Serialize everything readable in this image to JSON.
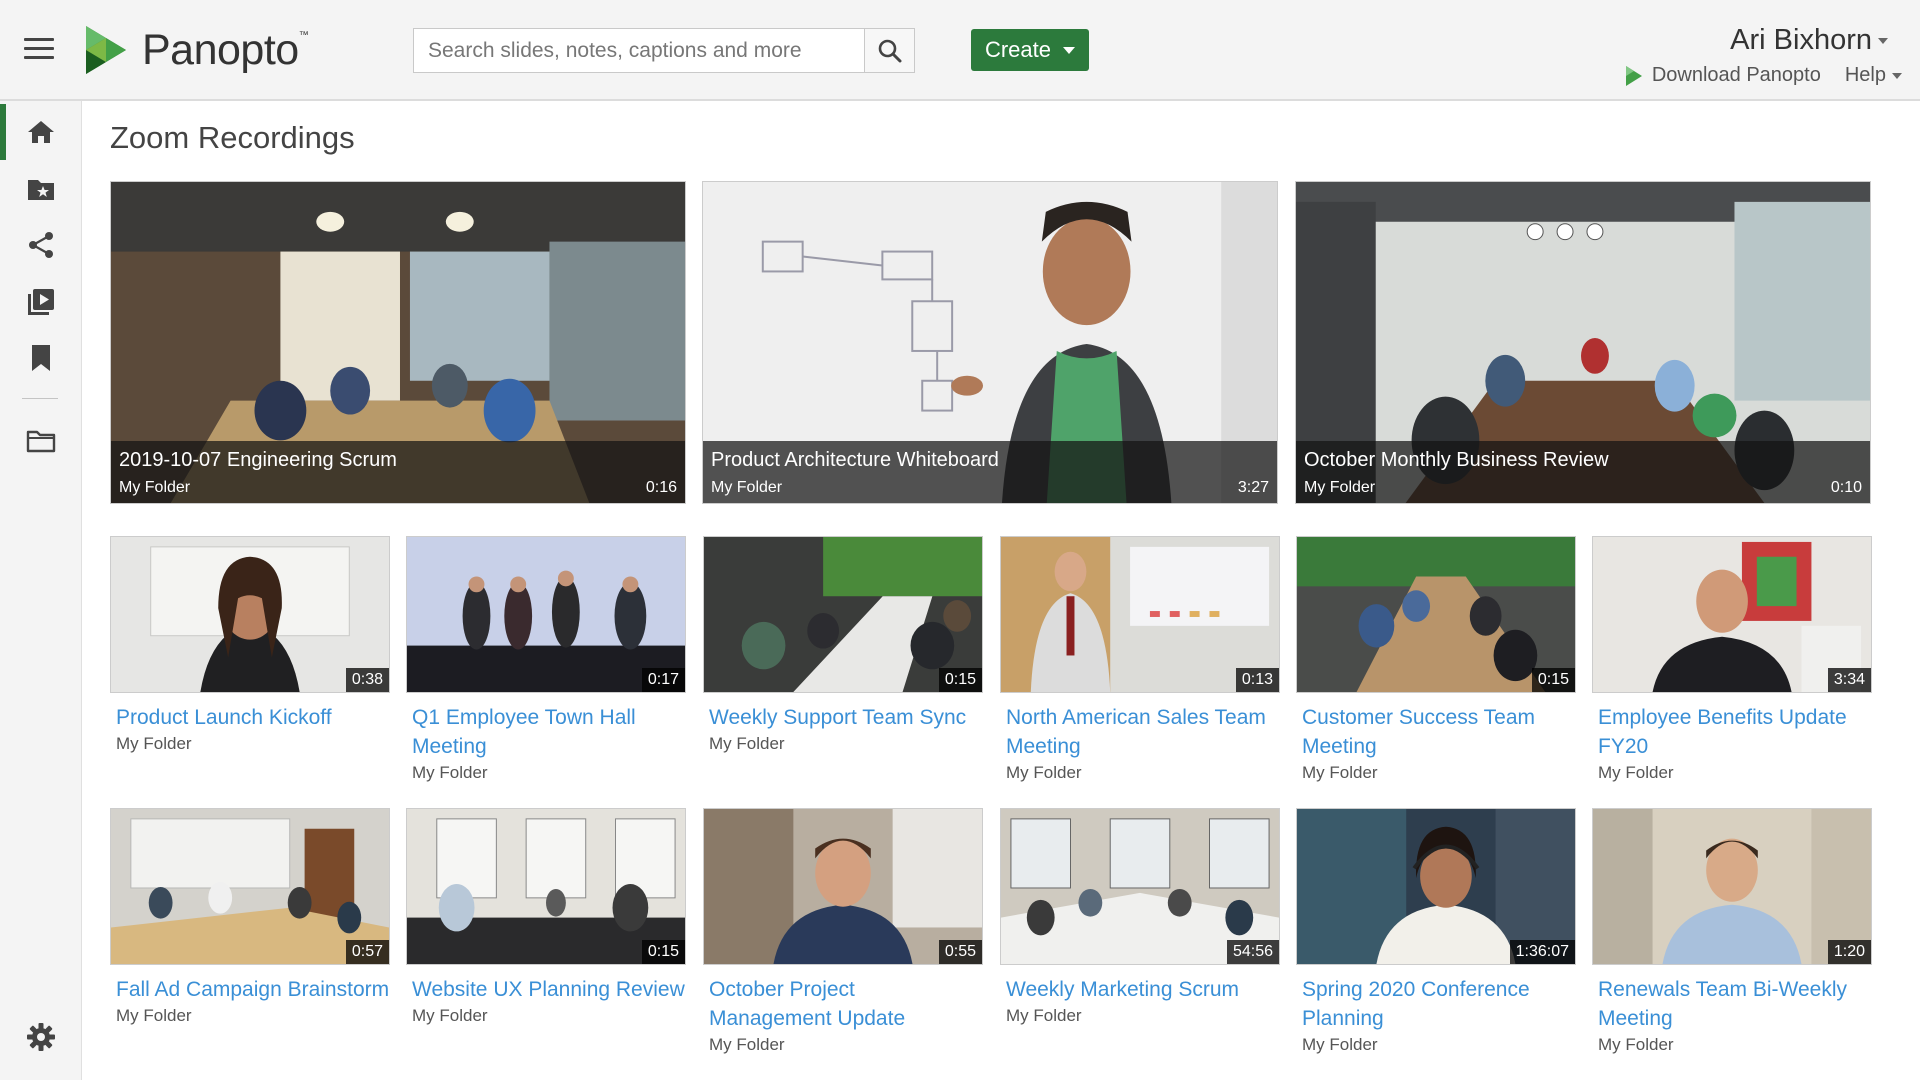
{
  "header": {
    "logo_text": "Panopto",
    "search_placeholder": "Search slides, notes, captions and more",
    "create_label": "Create",
    "user_name": "Ari Bixhorn",
    "download_label": "Download Panopto",
    "help_label": "Help"
  },
  "sidebar": {
    "items": [
      {
        "icon": "home-icon"
      },
      {
        "icon": "starred-folder-icon"
      },
      {
        "icon": "share-icon"
      },
      {
        "icon": "video-library-icon"
      },
      {
        "icon": "bookmark-icon"
      },
      {
        "icon": "folder-icon"
      },
      {
        "icon": "settings-icon"
      }
    ]
  },
  "main": {
    "title": "Zoom Recordings",
    "featured": [
      {
        "title": "2019-10-07 Engineering Scrum",
        "folder": "My Folder",
        "duration": "0:16"
      },
      {
        "title": "Product Architecture Whiteboard",
        "folder": "My Folder",
        "duration": "3:27"
      },
      {
        "title": "October Monthly Business Review",
        "folder": "My Folder",
        "duration": "0:10"
      }
    ],
    "row1": [
      {
        "title": "Product Launch Kickoff",
        "folder": "My Folder",
        "duration": "0:38"
      },
      {
        "title": "Q1 Employee Town Hall Meeting",
        "folder": "My Folder",
        "duration": "0:17"
      },
      {
        "title": "Weekly Support Team Sync",
        "folder": "My Folder",
        "duration": "0:15"
      },
      {
        "title": "North American Sales Team Meeting",
        "folder": "My Folder",
        "duration": "0:13"
      },
      {
        "title": "Customer Success Team Meeting",
        "folder": "My Folder",
        "duration": "0:15"
      },
      {
        "title": "Employee Benefits Update FY20",
        "folder": "My Folder",
        "duration": "3:34"
      }
    ],
    "row2": [
      {
        "title": "Fall Ad Campaign Brainstorm",
        "folder": "My Folder",
        "duration": "0:57"
      },
      {
        "title": "Website UX Planning Review",
        "folder": "My Folder",
        "duration": "0:15"
      },
      {
        "title": "October Project Management Update",
        "folder": "My Folder",
        "duration": "0:55"
      },
      {
        "title": "Weekly Marketing Scrum",
        "folder": "My Folder",
        "duration": "54:56"
      },
      {
        "title": "Spring 2020 Conference Planning",
        "folder": "My Folder",
        "duration": "1:36:07"
      },
      {
        "title": "Renewals Team Bi-Weekly Meeting",
        "folder": "My Folder",
        "duration": "1:20"
      }
    ]
  },
  "colors": {
    "brand_green": "#2c7a3c",
    "link_blue": "#3a8fd6",
    "header_bg": "#f4f4f4"
  }
}
